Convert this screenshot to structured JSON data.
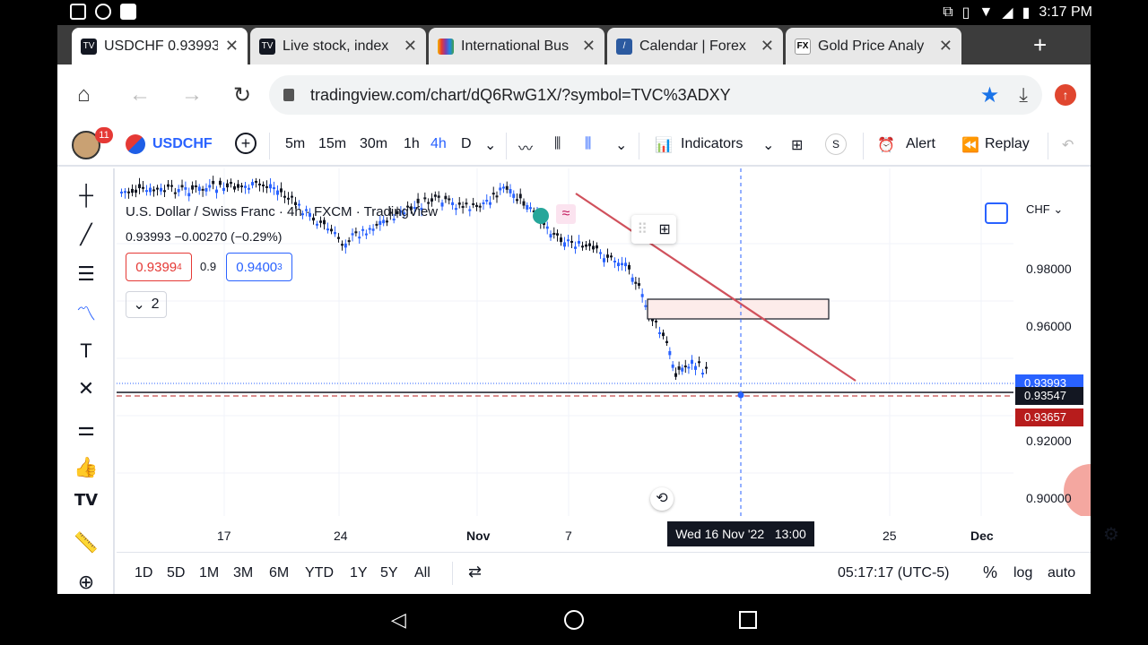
{
  "status": {
    "time": "3:17 PM"
  },
  "tabs": [
    {
      "title": "USDCHF 0.93993",
      "icon": "tradingview-icon"
    },
    {
      "title": "Live stock, index",
      "icon": "tradingview-icon"
    },
    {
      "title": "International Bus",
      "icon": "cnbc-icon"
    },
    {
      "title": "Calendar | Forex",
      "icon": "forexfactory-icon"
    },
    {
      "title": "Gold Price Analy",
      "icon": "fxstreet-icon"
    }
  ],
  "omnibox": {
    "url": "tradingview.com/chart/dQ6RwG1X/?symbol=TVC%3ADXY"
  },
  "tvbar": {
    "badge": "11",
    "symbol": "USDCHF",
    "intervals": [
      "5m",
      "15m",
      "30m",
      "1h",
      "4h",
      "D"
    ],
    "active_interval": "4h",
    "indicators": "Indicators",
    "s_label": "S",
    "alert": "Alert",
    "replay": "Replay"
  },
  "legend": {
    "title": "U.S. Dollar / Swiss Franc · 4h · FXCM · TradingView",
    "ohlc": "0.93993  −0.00270 (−0.29%)",
    "bid_main": "0.9399",
    "bid_sup": "4",
    "spread": "0.9",
    "ask_main": "0.9400",
    "ask_sup": "3",
    "indicator_count": "2"
  },
  "price_axis": {
    "currency": "CHF",
    "ticks": [
      "0.98000",
      "0.96000",
      "0.92000",
      "0.90000"
    ],
    "labels": [
      {
        "value": "0.93993",
        "color": "#2962ff"
      },
      {
        "value": "0.93547",
        "color": "#131722"
      },
      {
        "value": "0.93657",
        "color": "#b71c1c"
      }
    ]
  },
  "time_axis": {
    "ticks": [
      "17",
      "24",
      "Nov",
      "7",
      "25",
      "Dec"
    ],
    "crosshair_label": "Wed 16 Nov '22   13:00"
  },
  "bottom": {
    "ranges": [
      "1D",
      "5D",
      "1M",
      "3M",
      "6M",
      "YTD",
      "1Y",
      "5Y",
      "All"
    ],
    "clock": "05:17:17 (UTC-5)",
    "percent": "%",
    "log": "log",
    "auto": "auto"
  },
  "colors": {
    "up": "#2962ff",
    "down": "#131722",
    "trendline": "#d0515c",
    "zone_fill": "#fdecea"
  }
}
